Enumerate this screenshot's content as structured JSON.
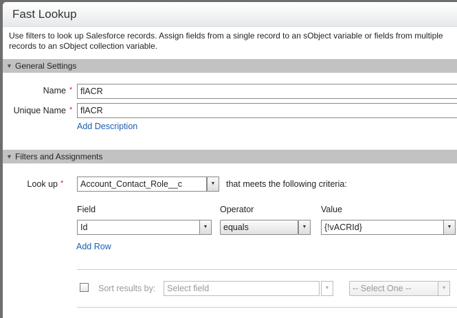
{
  "dialog": {
    "title": "Fast Lookup",
    "description": "Use filters to look up Salesforce records. Assign fields from a single record to an sObject variable or fields from multiple records to an sObject collection variable."
  },
  "general": {
    "header": "General Settings",
    "name_label": "Name",
    "name_value": "flACR",
    "unique_label": "Unique Name",
    "unique_value": "flACR",
    "add_description": "Add Description"
  },
  "filters": {
    "header": "Filters and Assignments",
    "lookup_label": "Look up",
    "lookup_value": "Account_Contact_Role__c",
    "criteria_text": "that meets the following criteria:",
    "columns": [
      "Field",
      "Operator",
      "Value"
    ],
    "rows": [
      {
        "field": "Id",
        "operator": "equals",
        "value": "{!vACRId}"
      }
    ],
    "add_row": "Add Row",
    "sort_label": "Sort results by:",
    "sort_field_placeholder": "Select field",
    "sort_order": "-- Select One --",
    "sort_checked": false
  },
  "required_mark": "*",
  "icons": {
    "dropdown": "▼",
    "collapse": "▼"
  }
}
